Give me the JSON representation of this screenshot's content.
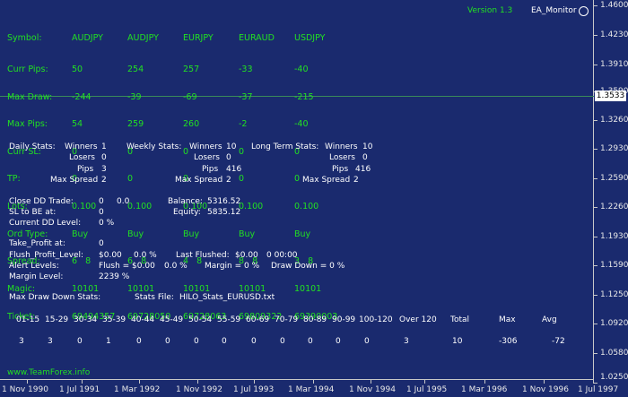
{
  "header": {
    "version": "Version  1.3",
    "ea_name": "EA_Monitor"
  },
  "table": {
    "labels": [
      "Symbol:",
      "Curr Pips:",
      "Max Draw:",
      "Max Pips:",
      "Curr SL:",
      "TP:",
      "Lots:",
      "Ord Type:",
      "Spread:",
      "Magic:",
      "Ticket:"
    ],
    "columns": [
      {
        "symbol": "AUDJPY",
        "values": [
          "50",
          "-244",
          "54",
          "0",
          "0",
          "0.100",
          "Buy",
          "6   8",
          "10101",
          "69494357"
        ]
      },
      {
        "symbol": "AUDJPY",
        "values": [
          "254",
          "-39",
          "259",
          "0",
          "0",
          "0.100",
          "Buy",
          "6   8",
          "10101",
          "69728050"
        ]
      },
      {
        "symbol": "EURJPY",
        "values": [
          "257",
          "-69",
          "260",
          "0",
          "0",
          "0.100",
          "Buy",
          "4   8",
          "10101",
          "69728063"
        ]
      },
      {
        "symbol": "EURAUD",
        "values": [
          "-33",
          "-37",
          "-2",
          "0",
          "0",
          "0.100",
          "Buy",
          "8   8",
          "10101",
          "69809322"
        ]
      },
      {
        "symbol": "USDJPY",
        "values": [
          "-40",
          "-215",
          "-40",
          "0",
          "0",
          "0.100",
          "Buy",
          "3   8",
          "10101",
          "69390003"
        ]
      }
    ]
  },
  "daily": {
    "title": "Daily Stats:",
    "winners_label": "Winners",
    "winners": "1",
    "losers_label": "Losers",
    "losers": "0",
    "pips_label": "Pips",
    "pips": "3",
    "maxspread_label": "Max Spread",
    "maxspread": "2"
  },
  "weekly": {
    "title": "Weekly Stats:",
    "winners_label": "Winners",
    "winners": "10",
    "losers_label": "Losers",
    "losers": "0",
    "pips_label": "Pips",
    "pips": "416",
    "maxspread_label": "Max Spread",
    "maxspread": "2"
  },
  "longterm": {
    "title": "Long Term Stats:",
    "winners_label": "Winners",
    "winners": "10",
    "losers_label": "Losers",
    "losers": "0",
    "pips_label": "Pips",
    "pips": "416",
    "maxspread_label": "Max Spread",
    "maxspread": "2"
  },
  "dd": {
    "close_label": "Close DD Trade:",
    "close_v1": "0",
    "close_v2": "0.0",
    "sl_label": "SL to BE at:",
    "sl_val": "0",
    "level_label": "Current DD Level:",
    "level_val": "0 %",
    "balance_label": "Balance:",
    "balance": "5316.52",
    "equity_label": "Equity:",
    "equity": "5835.12"
  },
  "profit": {
    "tp_label": "Take_Profit at:",
    "tp_val": "0",
    "flush_label": "Flush_Profit_Level:",
    "flush_val": "$0.00",
    "flush_pct": "0.0 %",
    "last_label": "Last Flushed:",
    "last_val": "$0.00",
    "last_time": "0  00:00",
    "alert_label": "Alert Levels:",
    "alert_flush": "Flush = $0.00",
    "alert_pct": "0.0 %",
    "alert_margin": "Margin = 0 %",
    "alert_dd": "Draw Down = 0 %",
    "margin_label": "Margin Level:",
    "margin_val": "2239 %"
  },
  "dd_stats": {
    "title": "Max Draw Down Stats:",
    "file_label": "Stats File:",
    "file": "HILO_Stats_EURUSD.txt",
    "headers": [
      "01-15",
      "15-29",
      "30-34",
      "35-39",
      "40-44",
      "45-49",
      "50-54",
      "55-59",
      "60-69",
      "70-79",
      "80-89",
      "90-99",
      "100-120",
      "Over 120",
      "Total",
      "Max",
      "Avg"
    ],
    "values": [
      "3",
      "3",
      "0",
      "1",
      "0",
      "0",
      "0",
      "0",
      "0",
      "0",
      "0",
      "0",
      "0",
      "3",
      "10",
      "-306",
      "-72"
    ]
  },
  "footer": {
    "site": "www.TeamForex.info"
  },
  "chart": {
    "y_ticks": [
      "1.4600",
      "1.4230",
      "1.3910",
      "1.3590",
      "1.3260",
      "1.2930",
      "1.2590",
      "1.2260",
      "1.1930",
      "1.1590",
      "1.1250",
      "1.0920",
      "1.0580",
      "1.0250"
    ],
    "current_price": "1.3533",
    "x_ticks": [
      "1 Nov 1990",
      "1 Jul 1991",
      "1 Mar 1992",
      "1 Nov 1992",
      "1 Jul 1993",
      "1 Mar 1994",
      "1 Nov 1994",
      "1 Jul 1995",
      "1 Mar 1996",
      "1 Nov 1996",
      "1 Jul 1997"
    ]
  },
  "colors": {
    "background": "#1a2a6e",
    "text_green": "#22e022",
    "text_white": "#ffffff",
    "level_line": "#3a8a5a"
  }
}
